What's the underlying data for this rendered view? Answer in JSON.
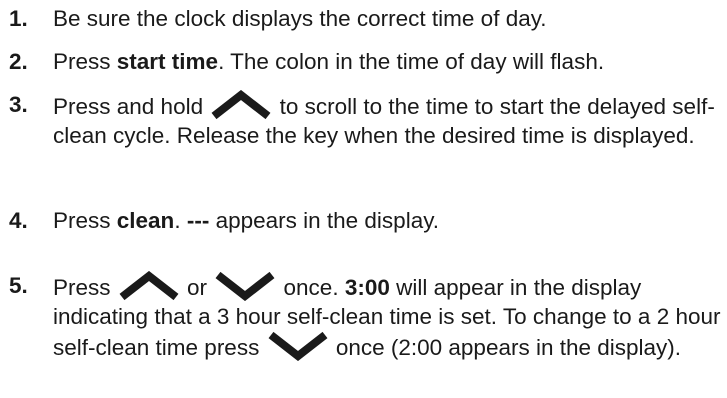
{
  "steps": [
    {
      "number": "1.",
      "text": "Be sure the clock displays the correct time of day."
    },
    {
      "number": "2.",
      "t1": "Press ",
      "bold": "start time",
      "t2": ". The colon in the time of day will flash."
    },
    {
      "number": "3.",
      "t1": "Press and hold ",
      "icon": "chevron-up-icon",
      "t2": " to scroll to the time to start the delayed self-clean cycle. Release the key when the desired time is displayed."
    },
    {
      "number": "4.",
      "t1": "Press ",
      "bold1": "clean",
      "t2": ". ",
      "bold2": "---",
      "t3": " appears in the display."
    },
    {
      "number": "5.",
      "t1": "Press ",
      "icon1": "chevron-up-icon",
      "t2": " or ",
      "icon2": "chevron-down-icon",
      "t3": " once. ",
      "bold": "3:00",
      "t4": " will appear in the display indicating that a 3 hour self-clean time is set. To change to a 2 hour self-clean time press ",
      "icon3": "chevron-down-icon",
      "t5": " once (2:00 appears in the display)."
    }
  ]
}
